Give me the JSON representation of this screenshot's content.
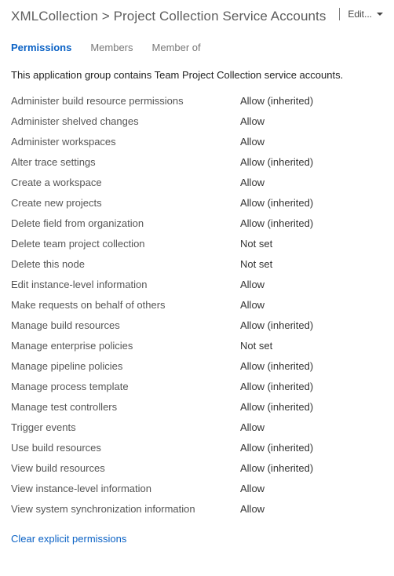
{
  "header": {
    "breadcrumb": "XMLCollection > Project Collection Service Accounts",
    "edit_label": "Edit..."
  },
  "tabs": [
    {
      "label": "Permissions",
      "active": true
    },
    {
      "label": "Members",
      "active": false
    },
    {
      "label": "Member of",
      "active": false
    }
  ],
  "description": "This application group contains Team Project Collection service accounts.",
  "permissions": [
    {
      "name": "Administer build resource permissions",
      "value": "Allow (inherited)"
    },
    {
      "name": "Administer shelved changes",
      "value": "Allow"
    },
    {
      "name": "Administer workspaces",
      "value": "Allow"
    },
    {
      "name": "Alter trace settings",
      "value": "Allow (inherited)"
    },
    {
      "name": "Create a workspace",
      "value": "Allow"
    },
    {
      "name": "Create new projects",
      "value": "Allow (inherited)"
    },
    {
      "name": "Delete field from organization",
      "value": "Allow (inherited)"
    },
    {
      "name": "Delete team project collection",
      "value": "Not set"
    },
    {
      "name": "Delete this node",
      "value": "Not set"
    },
    {
      "name": "Edit instance-level information",
      "value": "Allow"
    },
    {
      "name": "Make requests on behalf of others",
      "value": "Allow"
    },
    {
      "name": "Manage build resources",
      "value": "Allow (inherited)"
    },
    {
      "name": "Manage enterprise policies",
      "value": "Not set"
    },
    {
      "name": "Manage pipeline policies",
      "value": "Allow (inherited)"
    },
    {
      "name": "Manage process template",
      "value": "Allow (inherited)"
    },
    {
      "name": "Manage test controllers",
      "value": "Allow (inherited)"
    },
    {
      "name": "Trigger events",
      "value": "Allow"
    },
    {
      "name": "Use build resources",
      "value": "Allow (inherited)"
    },
    {
      "name": "View build resources",
      "value": "Allow (inherited)"
    },
    {
      "name": "View instance-level information",
      "value": "Allow"
    },
    {
      "name": "View system synchronization information",
      "value": "Allow"
    }
  ],
  "footer": {
    "clear_label": "Clear explicit permissions"
  }
}
